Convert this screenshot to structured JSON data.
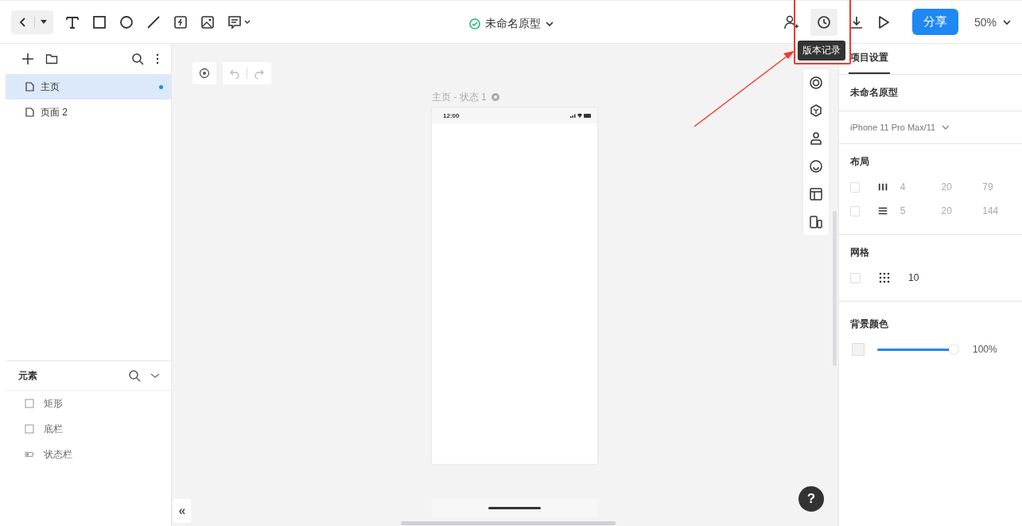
{
  "document": {
    "title": "未命名原型",
    "saved": true
  },
  "topbar": {
    "share": "分享",
    "zoom": "50%",
    "tooltip": "版本记录"
  },
  "pages": [
    {
      "label": "主页",
      "selected": true,
      "modified": true
    },
    {
      "label": "页面 2",
      "selected": false,
      "modified": false
    }
  ],
  "elements_panel": {
    "title": "元素",
    "items": [
      {
        "label": "矩形",
        "kind": "shape"
      },
      {
        "label": "底栏",
        "kind": "shape"
      },
      {
        "label": "状态栏",
        "kind": "statusbar"
      }
    ]
  },
  "collapse": "«",
  "canvas": {
    "frame_label": "主页 - 状态 1",
    "phone_time": "12:00",
    "help": "?"
  },
  "settings": {
    "tab": {
      "label": "项目设置",
      "selected": true
    },
    "project_name": "未命名原型",
    "device": "iPhone 11 Pro Max/11",
    "layout": {
      "title": "布局",
      "rows": [
        {
          "kind": "columns",
          "checked": false,
          "values": [
            "4",
            "20",
            "79"
          ]
        },
        {
          "kind": "rows",
          "checked": false,
          "values": [
            "5",
            "20",
            "144"
          ]
        }
      ]
    },
    "grid": {
      "title": "网格",
      "checked": false,
      "value": "10"
    },
    "background": {
      "title": "背景颜色",
      "level": 1,
      "reading": "100%"
    }
  }
}
